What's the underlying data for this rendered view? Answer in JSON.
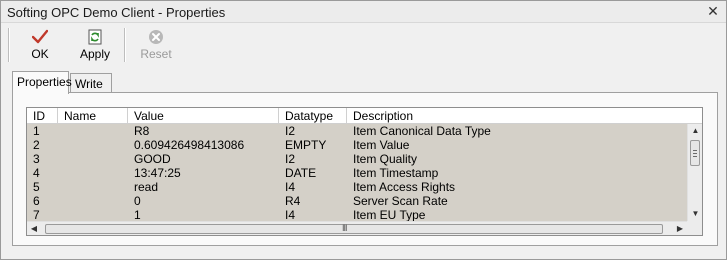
{
  "window": {
    "title": "Softing OPC Demo Client - Properties",
    "close_glyph": "✕"
  },
  "toolbar": {
    "ok_label": "OK",
    "apply_label": "Apply",
    "reset_label": "Reset"
  },
  "tabs": [
    {
      "label": "Properties",
      "active": true
    },
    {
      "label": "Write",
      "active": false
    }
  ],
  "table": {
    "columns": [
      "ID",
      "Name",
      "Value",
      "Datatype",
      "Description"
    ],
    "rows": [
      {
        "id": "1",
        "name": "",
        "value": "R8",
        "datatype": "I2",
        "description": "Item Canonical Data Type"
      },
      {
        "id": "2",
        "name": "",
        "value": "0.609426498413086",
        "datatype": "EMPTY",
        "description": "Item Value"
      },
      {
        "id": "3",
        "name": "",
        "value": "GOOD",
        "datatype": "I2",
        "description": "Item Quality"
      },
      {
        "id": "4",
        "name": "",
        "value": "13:47:25",
        "datatype": "DATE",
        "description": "Item Timestamp"
      },
      {
        "id": "5",
        "name": "",
        "value": "read",
        "datatype": "I4",
        "description": "Item Access Rights"
      },
      {
        "id": "6",
        "name": "",
        "value": "0",
        "datatype": "R4",
        "description": "Server Scan Rate"
      },
      {
        "id": "7",
        "name": "",
        "value": "1",
        "datatype": "I4",
        "description": "Item EU Type"
      }
    ]
  },
  "scrollbars": {
    "horizontal_grip": "III"
  },
  "colors": {
    "row_background": "#d4d0c8",
    "ok_check": "#c0392b",
    "apply_green": "#2e8b2e"
  }
}
